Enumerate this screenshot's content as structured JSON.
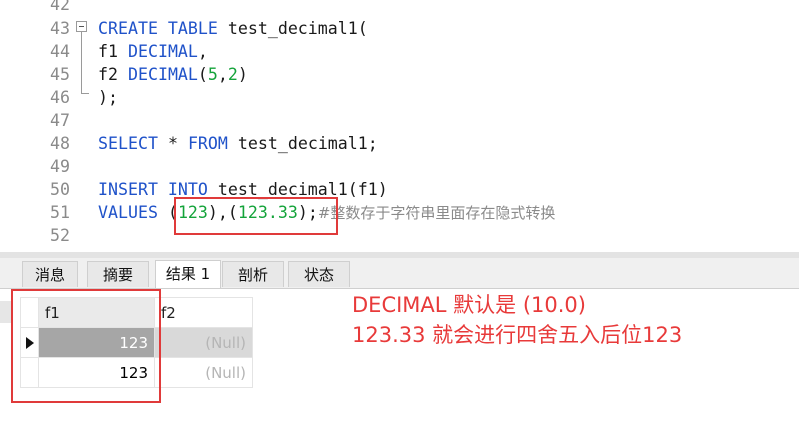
{
  "editor": {
    "lines": [
      {
        "n": "42",
        "parts": []
      },
      {
        "n": "43",
        "parts": [
          {
            "t": "CREATE TABLE ",
            "c": "kw"
          },
          {
            "t": "test_decimal1(",
            "c": ""
          }
        ]
      },
      {
        "n": "44",
        "parts": [
          {
            "t": "f1 ",
            "c": ""
          },
          {
            "t": "DECIMAL",
            "c": "kw"
          },
          {
            "t": ",",
            "c": ""
          }
        ]
      },
      {
        "n": "45",
        "parts": [
          {
            "t": "f2 ",
            "c": ""
          },
          {
            "t": "DECIMAL",
            "c": "kw"
          },
          {
            "t": "(",
            "c": ""
          },
          {
            "t": "5",
            "c": "num"
          },
          {
            "t": ",",
            "c": ""
          },
          {
            "t": "2",
            "c": "num"
          },
          {
            "t": ")",
            "c": ""
          }
        ]
      },
      {
        "n": "46",
        "parts": [
          {
            "t": ");",
            "c": ""
          }
        ]
      },
      {
        "n": "47",
        "parts": []
      },
      {
        "n": "48",
        "parts": [
          {
            "t": "SELECT",
            "c": "kw"
          },
          {
            "t": " * ",
            "c": ""
          },
          {
            "t": "FROM",
            "c": "kw"
          },
          {
            "t": " test_decimal1;",
            "c": ""
          }
        ]
      },
      {
        "n": "49",
        "parts": []
      },
      {
        "n": "50",
        "parts": [
          {
            "t": "INSERT INTO",
            "c": "kw"
          },
          {
            "t": " test_decimal1(f1)",
            "c": ""
          }
        ]
      },
      {
        "n": "51",
        "parts": [
          {
            "t": "VALUES",
            "c": "kw"
          },
          {
            "t": " (",
            "c": ""
          },
          {
            "t": "123",
            "c": "num"
          },
          {
            "t": "),(",
            "c": ""
          },
          {
            "t": "123.33",
            "c": "num"
          },
          {
            "t": ");",
            "c": ""
          },
          {
            "t": "#整数存于字符串里面存在隐式转换",
            "c": "cmt"
          }
        ]
      },
      {
        "n": "52",
        "parts": []
      }
    ]
  },
  "tabs": [
    {
      "label": "消息",
      "active": false
    },
    {
      "label": "摘要",
      "active": false
    },
    {
      "label": "结果 1",
      "active": true
    },
    {
      "label": "剖析",
      "active": false
    },
    {
      "label": "状态",
      "active": false
    }
  ],
  "grid": {
    "columns": [
      "f1",
      "f2"
    ],
    "rows": [
      {
        "f1": "123",
        "f2": "(Null)"
      },
      {
        "f1": "123",
        "f2": "(Null)"
      }
    ]
  },
  "annotation": {
    "line1": "DECIMAL 默认是 (10.0)",
    "line2": "123.33 就会进行四舍五入后位123"
  }
}
